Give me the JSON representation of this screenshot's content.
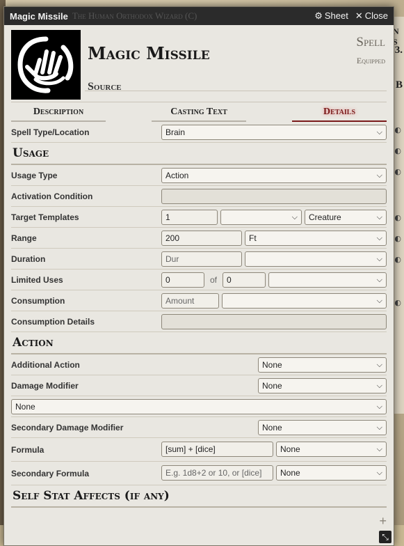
{
  "window": {
    "title": "Magic Missile",
    "subtitle": "The Human Orthodox Wizard (C)",
    "sheet_label": "Sheet",
    "close_label": "Close"
  },
  "item": {
    "name": "Magic Missile",
    "type": "Spell",
    "status": "Equipped",
    "source": "Source"
  },
  "tabs": [
    {
      "label": "Description"
    },
    {
      "label": "Casting Text"
    },
    {
      "label": "Details"
    }
  ],
  "spell_type": {
    "label": "Spell Type/Location",
    "value": "Brain"
  },
  "sections": {
    "usage": "Usage",
    "action": "Action",
    "self_stat": "Self Stat Affects (if any)"
  },
  "usage": {
    "usage_type": {
      "label": "Usage Type",
      "value": "Action"
    },
    "activation": {
      "label": "Activation Condition",
      "value": ""
    },
    "target": {
      "label": "Target Templates",
      "value": "1",
      "mid": "",
      "type": "Creature"
    },
    "range": {
      "label": "Range",
      "value": "200",
      "unit": "Ft"
    },
    "duration": {
      "label": "Duration",
      "placeholder": "Dur",
      "unit": ""
    },
    "limited": {
      "label": "Limited Uses",
      "value": "0",
      "of": "of",
      "max": "0",
      "per": ""
    },
    "consumption": {
      "label": "Consumption",
      "placeholder": "Amount",
      "target": ""
    },
    "consumption_details": {
      "label": "Consumption Details",
      "value": ""
    }
  },
  "action": {
    "additional": {
      "label": "Additional Action",
      "value": "None"
    },
    "damage_mod": {
      "label": "Damage Modifier",
      "value": "None"
    },
    "damage_mod_full": {
      "value": "None"
    },
    "secondary_mod": {
      "label": "Secondary Damage Modifier",
      "value": "None"
    },
    "formula": {
      "label": "Formula",
      "value": "[sum] + [dice]",
      "type": "None"
    },
    "secondary_formula": {
      "label": "Secondary Formula",
      "placeholder": "E.g. 1d8+2 or 10, or [dice]",
      "type": "None"
    }
  },
  "footer": {
    "add": "+",
    "resize": "⤡"
  },
  "background": {
    "right_text_1": "N S",
    "right_text_2": "3.",
    "right_text_3": "B"
  }
}
